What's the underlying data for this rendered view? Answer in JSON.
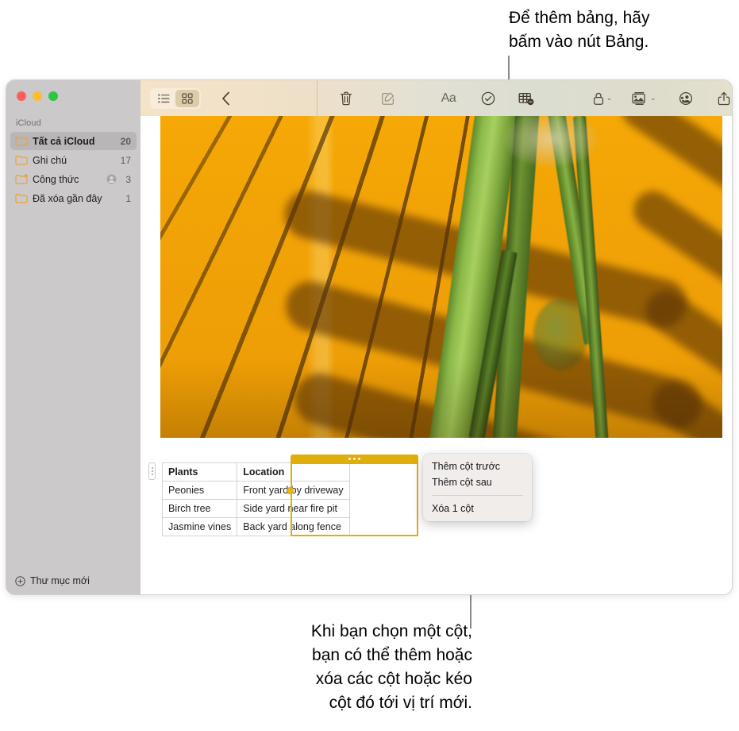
{
  "callouts": {
    "top": "Để thêm bảng, hãy\nbấm vào nút Bảng.",
    "bottom": "Khi bạn chọn một cột,\nbạn có thể thêm hoặc\nxóa các cột hoặc kéo\ncột đó tới vị trí mới."
  },
  "window": {
    "traffic_lights": [
      "close",
      "minimize",
      "zoom"
    ]
  },
  "sidebar": {
    "section_title": "iCloud",
    "items": [
      {
        "label": "Tất cả iCloud",
        "count": "20",
        "icon": "folder-icon",
        "selected": true,
        "shared": false
      },
      {
        "label": "Ghi chú",
        "count": "17",
        "icon": "folder-icon",
        "selected": false,
        "shared": false
      },
      {
        "label": "Công thức",
        "count": "3",
        "icon": "folder-shared-icon",
        "selected": false,
        "shared": true
      },
      {
        "label": "Đã xóa gần đây",
        "count": "1",
        "icon": "folder-icon",
        "selected": false,
        "shared": false
      }
    ],
    "new_folder_label": "Thư mục mới",
    "new_folder_icon": "plus-circle-icon"
  },
  "toolbar": {
    "buttons": [
      {
        "name": "list-view-icon",
        "label": ""
      },
      {
        "name": "grid-view-icon",
        "label": ""
      },
      {
        "name": "back-chevron-icon",
        "label": ""
      },
      {
        "name": "trash-icon",
        "label": ""
      },
      {
        "name": "compose-icon",
        "label": ""
      },
      {
        "name": "format-aa-icon",
        "label": "Aa"
      },
      {
        "name": "checklist-icon",
        "label": ""
      },
      {
        "name": "table-icon",
        "label": ""
      },
      {
        "name": "lock-icon",
        "label": ""
      },
      {
        "name": "media-icon",
        "label": ""
      },
      {
        "name": "collaborate-icon",
        "label": ""
      },
      {
        "name": "share-icon",
        "label": ""
      },
      {
        "name": "search-icon",
        "label": ""
      }
    ],
    "aa_label": "Aa",
    "chevron": "⌄"
  },
  "note": {
    "photo_alt": "palm-frond-shadow-on-orange-wall",
    "table": {
      "columns": [
        "Plants",
        "Location"
      ],
      "rows": [
        [
          "Peonies",
          "Front yard by driveway"
        ],
        [
          "Birch tree",
          "Side yard near fire pit"
        ],
        [
          "Jasmine vines",
          "Back yard along fence"
        ]
      ],
      "selected_column_index": 1,
      "selection_color": "#e0ae0c",
      "handle_dots": "column-options-dots"
    }
  },
  "context_menu": {
    "items": [
      {
        "label": "Thêm cột trước"
      },
      {
        "label": "Thêm cột sau"
      },
      {
        "label": "Xóa 1 cột"
      }
    ]
  }
}
